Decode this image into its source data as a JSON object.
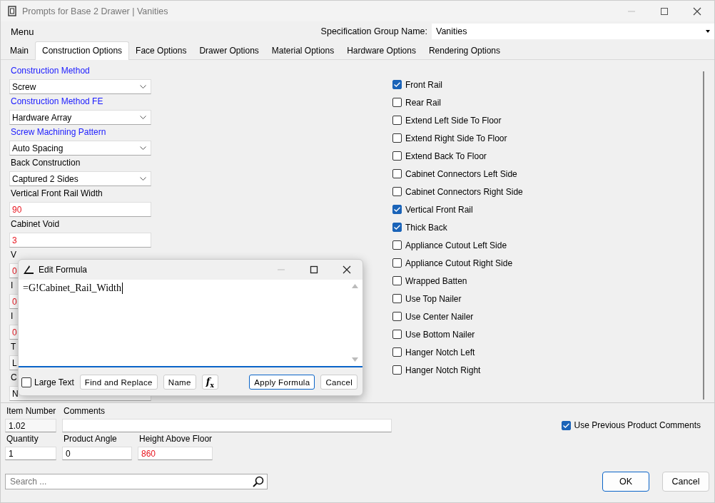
{
  "window": {
    "title": "Prompts for Base 2 Drawer | Vanities"
  },
  "menu": {
    "label": "Menu",
    "spec_label": "Specification Group Name:",
    "spec_value": "Vanities"
  },
  "tabs": [
    {
      "label": "Main",
      "selected": false
    },
    {
      "label": "Construction Options",
      "selected": true
    },
    {
      "label": "Face Options",
      "selected": false
    },
    {
      "label": "Drawer Options",
      "selected": false
    },
    {
      "label": "Material Options",
      "selected": false
    },
    {
      "label": "Hardware Options",
      "selected": false
    },
    {
      "label": "Rendering Options",
      "selected": false
    }
  ],
  "fields": [
    {
      "label": "Construction Method",
      "highlighted": true,
      "kind": "dropdown",
      "value": "Screw",
      "overridden": false
    },
    {
      "label": "Construction Method FE",
      "highlighted": true,
      "kind": "dropdown",
      "value": "Hardware Array",
      "overridden": false
    },
    {
      "label": "Screw Machining Pattern",
      "highlighted": true,
      "kind": "dropdown",
      "value": "Auto Spacing",
      "overridden": false
    },
    {
      "label": "Back Construction",
      "highlighted": false,
      "kind": "dropdown",
      "value": "Captured 2 Sides",
      "overridden": false
    },
    {
      "label": "Vertical Front Rail Width",
      "highlighted": false,
      "kind": "text",
      "value": "90",
      "overridden": true
    },
    {
      "label": "Cabinet Void",
      "highlighted": false,
      "kind": "text",
      "value": "3",
      "overridden": true
    },
    {
      "label": "V",
      "highlighted": false,
      "kind": "text",
      "value": "0",
      "overridden": true
    },
    {
      "label": "I",
      "highlighted": false,
      "kind": "text",
      "value": "0",
      "overridden": true
    },
    {
      "label": "I",
      "highlighted": false,
      "kind": "text",
      "value": "0",
      "overridden": true
    },
    {
      "label": "T",
      "highlighted": false,
      "kind": "dropdown",
      "value": "L",
      "overridden": false
    },
    {
      "label": "C",
      "highlighted": false,
      "kind": "dropdown",
      "value": "N",
      "overridden": false
    }
  ],
  "checkboxes": [
    {
      "label": "Front Rail",
      "checked": true
    },
    {
      "label": "Rear Rail",
      "checked": false
    },
    {
      "label": "Extend Left Side To Floor",
      "checked": false
    },
    {
      "label": "Extend Right Side To Floor",
      "checked": false
    },
    {
      "label": "Extend Back To Floor",
      "checked": false
    },
    {
      "label": "Cabinet Connectors Left Side",
      "checked": false
    },
    {
      "label": "Cabinet Connectors Right Side",
      "checked": false
    },
    {
      "label": "Vertical Front Rail",
      "checked": true
    },
    {
      "label": "Thick Back",
      "checked": true
    },
    {
      "label": "Appliance Cutout Left Side",
      "checked": false
    },
    {
      "label": "Appliance Cutout Right Side",
      "checked": false
    },
    {
      "label": "Wrapped Batten",
      "checked": false
    },
    {
      "label": "Use Top Nailer",
      "checked": false
    },
    {
      "label": "Use Center Nailer",
      "checked": false
    },
    {
      "label": "Use Bottom Nailer",
      "checked": false
    },
    {
      "label": "Hanger Notch Left",
      "checked": false
    },
    {
      "label": "Hanger Notch Right",
      "checked": false
    }
  ],
  "dialog": {
    "title": "Edit Formula",
    "formula": "=G!Cabinet_Rail_Width",
    "large_text": {
      "label": "Large Text",
      "checked": false
    },
    "buttons": [
      "Find and Replace",
      "Name"
    ],
    "fx": "f",
    "fx_sub": "x",
    "apply": "Apply Formula",
    "cancel": "Cancel"
  },
  "bottom": {
    "item_number": {
      "label": "Item Number",
      "value": "1.02"
    },
    "comments": {
      "label": "Comments"
    },
    "use_previous": {
      "label": "Use Previous Product Comments",
      "checked": true
    },
    "quantity": {
      "label": "Quantity",
      "value": "1",
      "overridden": false
    },
    "angle": {
      "label": "Product Angle",
      "value": "0",
      "overridden": false
    },
    "height": {
      "label": "Height Above Floor",
      "value": "860",
      "overridden": true
    },
    "search": {
      "placeholder": "Search ..."
    },
    "ok": "OK",
    "cancel": "Cancel"
  }
}
